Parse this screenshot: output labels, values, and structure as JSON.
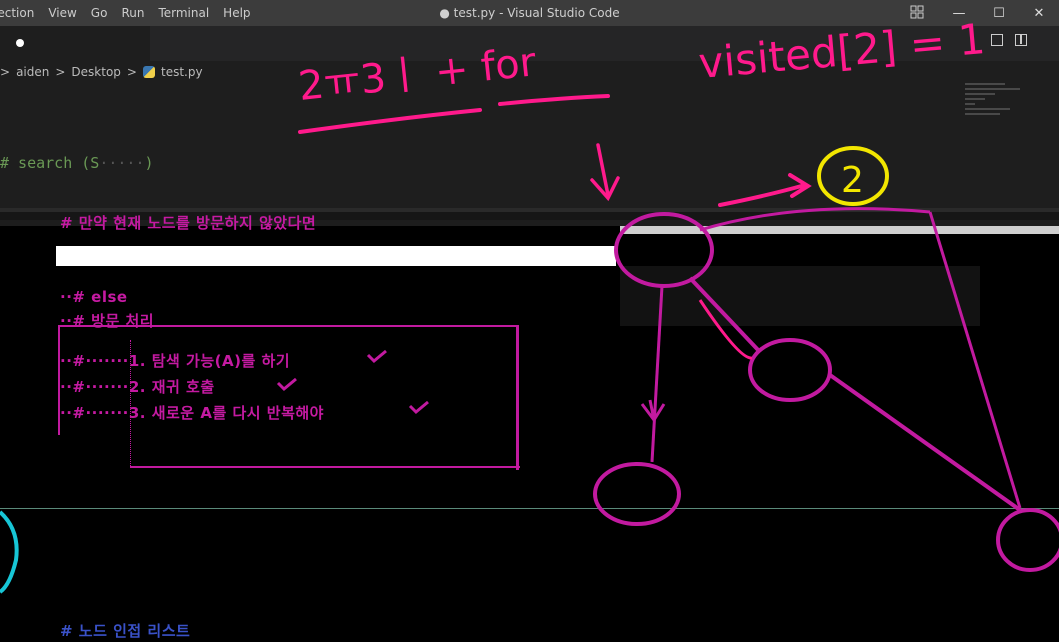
{
  "menu": {
    "items": [
      "lection",
      "View",
      "Go",
      "Run",
      "Terminal",
      "Help"
    ]
  },
  "window": {
    "title": "● test.py - Visual Studio Code"
  },
  "controls": {
    "minimize": "—",
    "maximize": "☐",
    "close": "✕"
  },
  "breadcrumb": {
    "parts": [
      "aiden",
      "Desktop",
      "test.py"
    ],
    "separator": ">"
  },
  "editor": {
    "comment_prefix": "# search (S",
    "comment_dots": "·····",
    "comment_suffix": ")"
  },
  "annotations": {
    "top_left": "2ㅠ3ㅣ + for",
    "top_right": "visited[2] = 1",
    "circle_label": "2"
  },
  "overlay_text": {
    "line1": "# 만약 현재 노드를 방문하지 않았다면",
    "line2": "··# else",
    "line3": "··# 방문 처리",
    "line4": "··#·······1. 탐색 가능(A)를 하기",
    "line5": "··#·······2. 재귀 호출",
    "line6": "··#·······3. 새로운 A를 다시 반복해야",
    "bottom": "# 노드 인접 리스트"
  },
  "colors": {
    "ink_pink": "#ff1a8c",
    "ink_yellow": "#f2e600",
    "ink_magenta": "#c21aa0",
    "ink_cyan": "#17c6d6"
  }
}
